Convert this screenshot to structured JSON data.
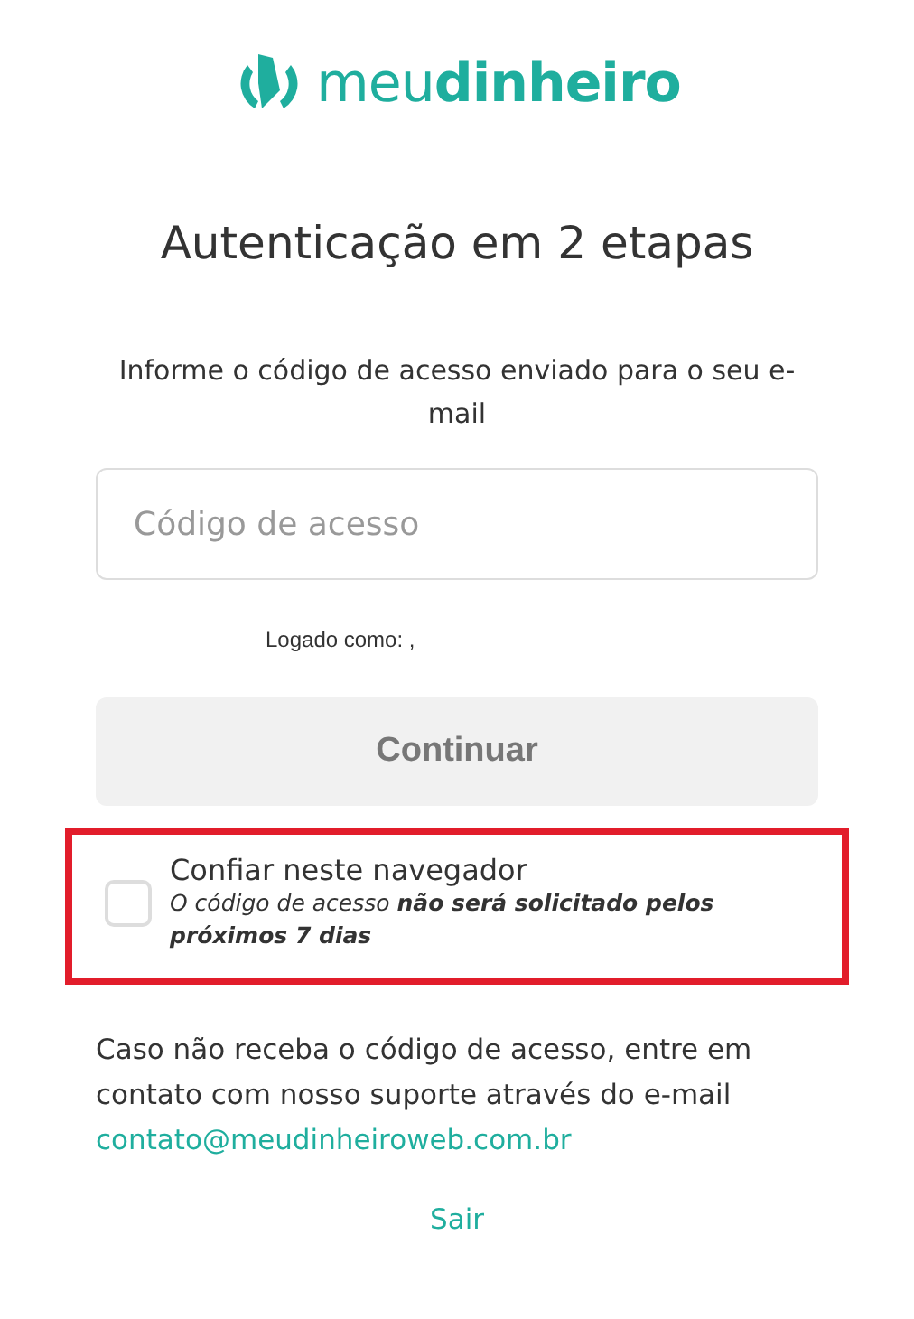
{
  "logo": {
    "text": "meu**dinheiro**"
  },
  "title": "Autenticação em 2 etapas",
  "instruction": "Informe o código de acesso enviado para o seu e-mail",
  "code_field": {
    "placeholder": "Código de acesso"
  },
  "logged_as": "Logado como: ,",
  "continue_button": {
    "label": "Continuar",
    "disabled": true
  },
  "trust_browser": {
    "label": "Confiar neste navegador",
    "hint": "O código de acesso **não será solicitado pelos próximos 7 dias**",
    "checked": false,
    "highlighted": true
  },
  "support_text": "Caso não receba o código de acesso, entre em contato com nosso suporte através do e-mail",
  "support_email": "contato@meudinheiroweb.com.br",
  "logout_link": "Sair"
}
